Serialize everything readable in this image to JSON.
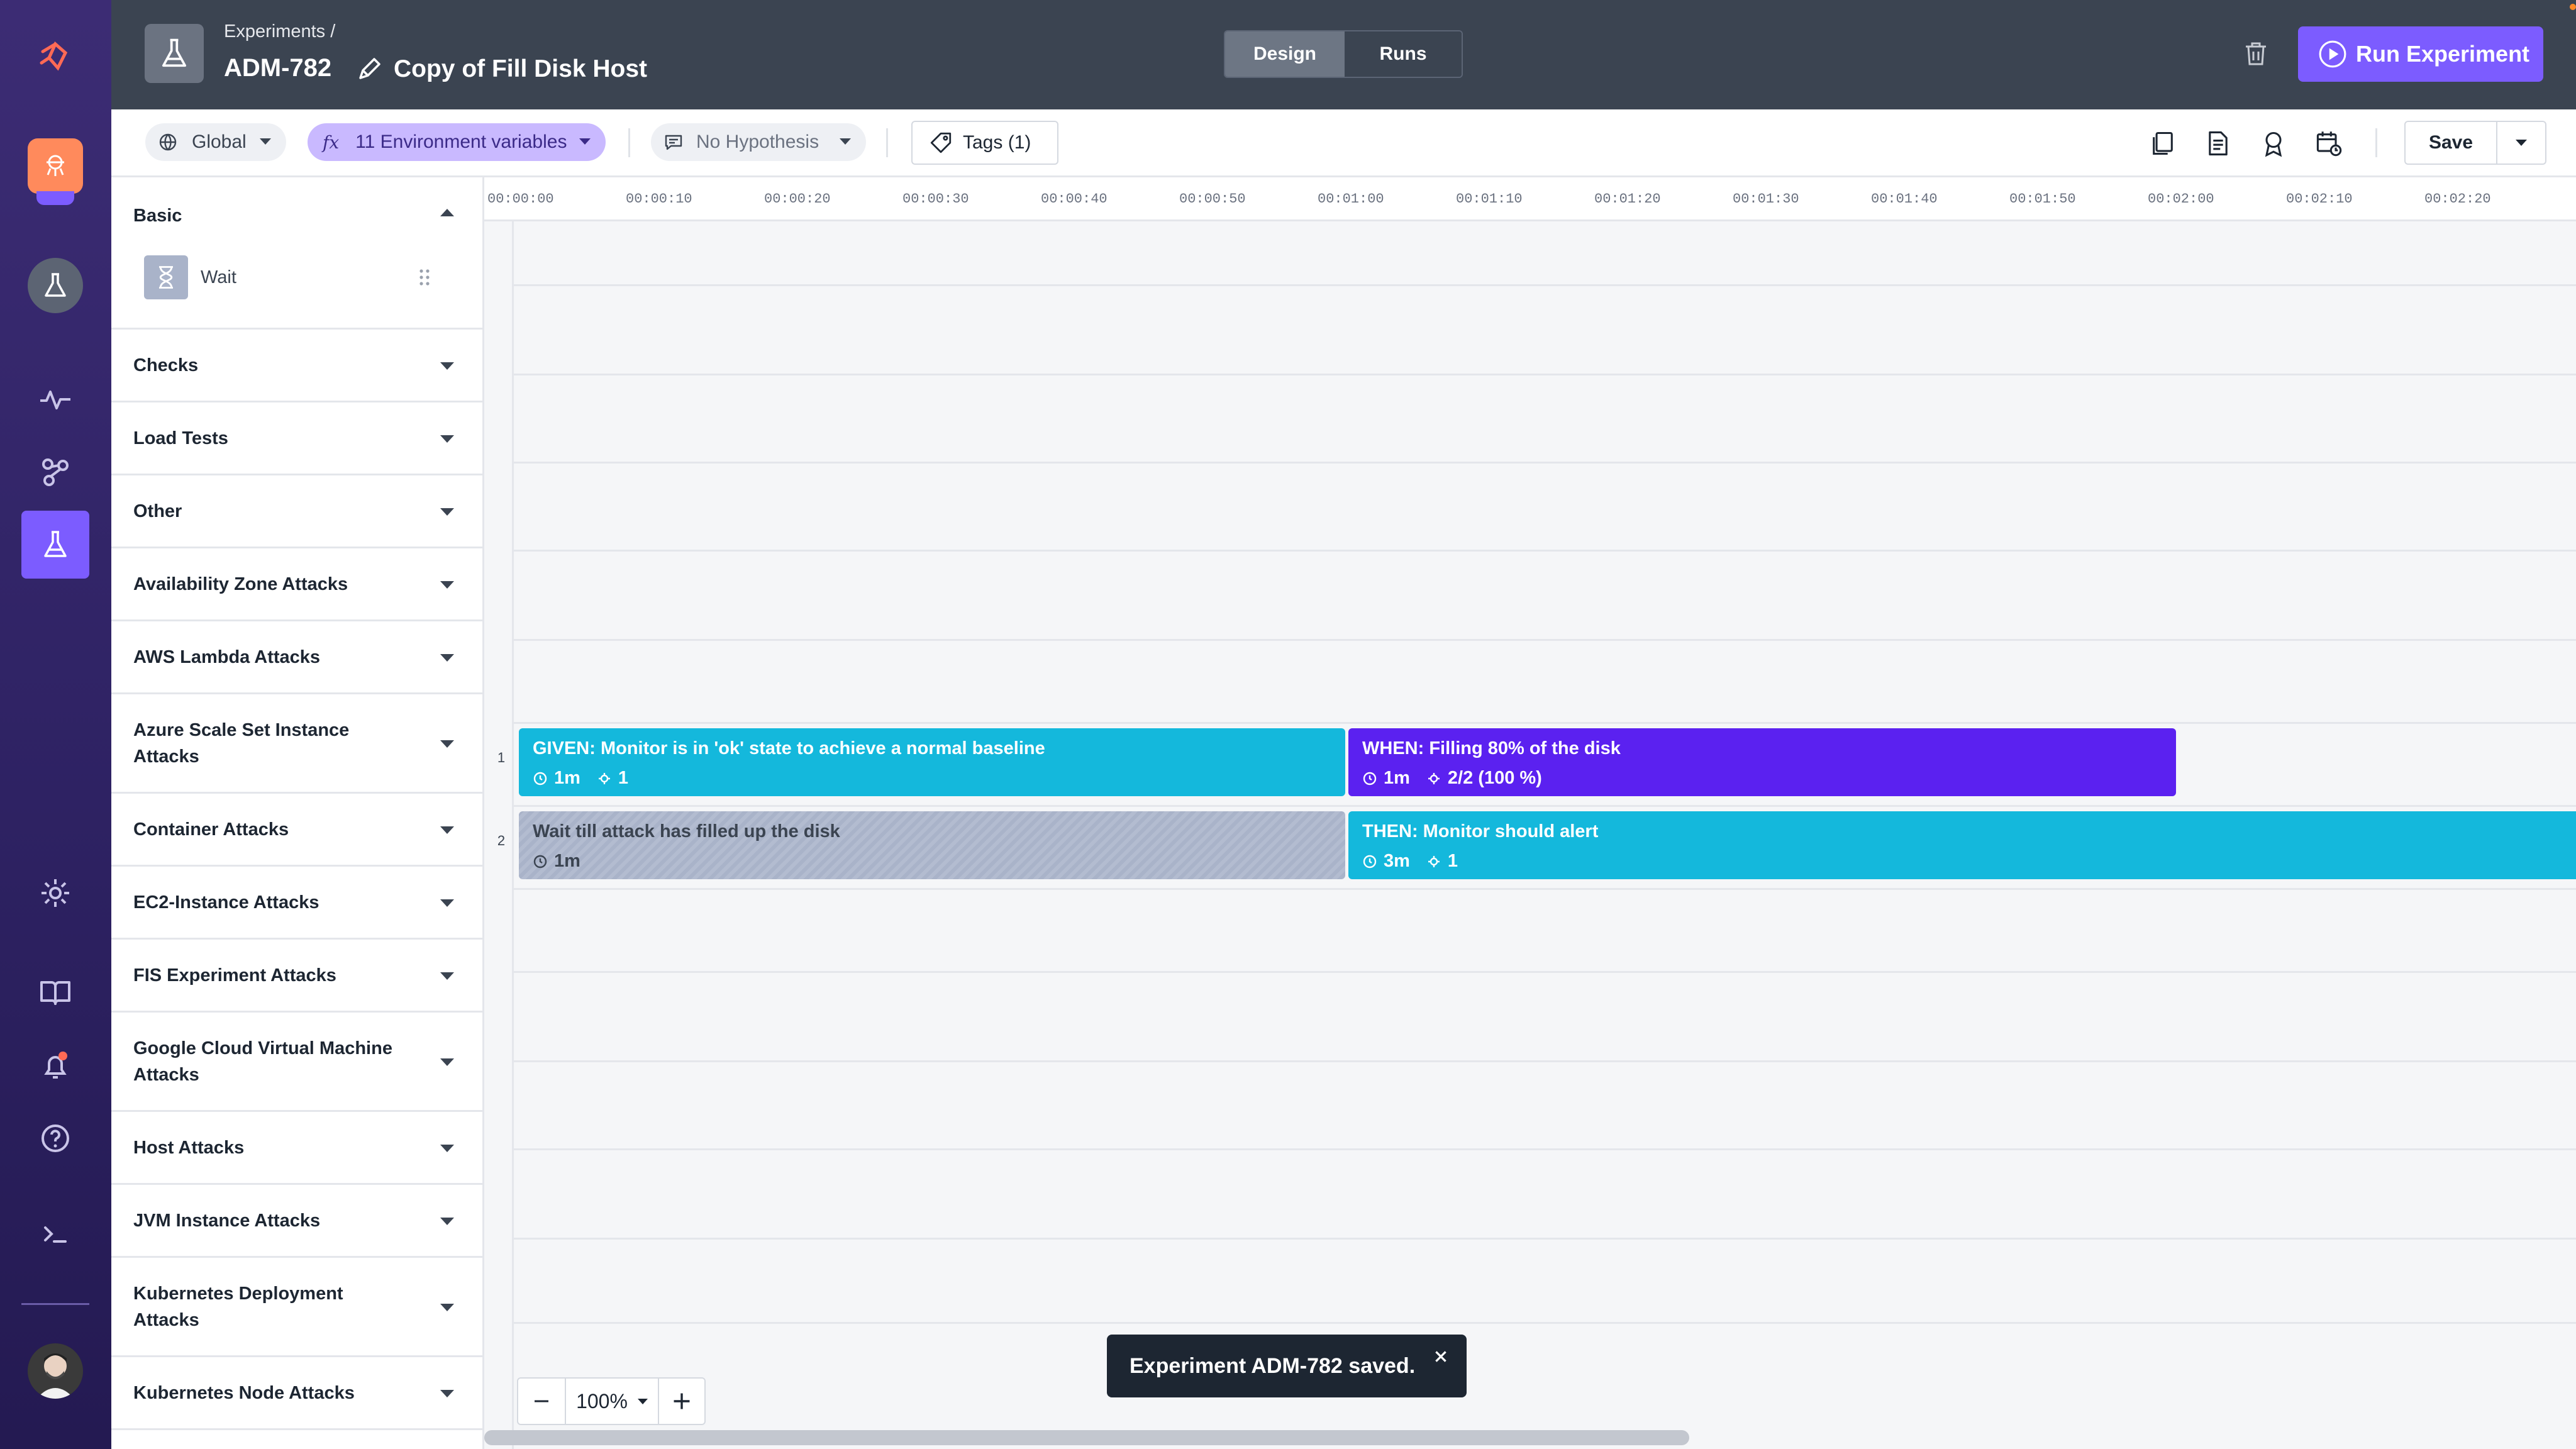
{
  "header": {
    "breadcrumb": "Experiments /",
    "experiment_id": "ADM-782",
    "experiment_name": "Copy of Fill Disk Host",
    "tabs": [
      {
        "label": "Design",
        "active": true
      },
      {
        "label": "Runs",
        "active": false
      }
    ],
    "run_button": "Run Experiment"
  },
  "toolbar": {
    "environment": "Global",
    "env_vars": "11 Environment variables",
    "hypothesis": "No Hypothesis",
    "tags": "Tags (1)",
    "save": "Save"
  },
  "sidebar": {
    "basic_label": "Basic",
    "basic_item": "Wait",
    "sections": [
      "Checks",
      "Load Tests",
      "Other",
      "Availability Zone Attacks",
      "AWS Lambda Attacks",
      "Azure Scale Set Instance Attacks",
      "Container Attacks",
      "EC2-Instance Attacks",
      "FIS Experiment Attacks",
      "Google Cloud Virtual Machine Attacks",
      "Host Attacks",
      "JVM Instance Attacks",
      "Kubernetes Deployment Attacks",
      "Kubernetes Node Attacks"
    ]
  },
  "timeline": {
    "ticks": [
      "00:00:00",
      "00:00:10",
      "00:00:20",
      "00:00:30",
      "00:00:40",
      "00:00:50",
      "00:01:00",
      "00:01:10",
      "00:01:20",
      "00:01:30",
      "00:01:40",
      "00:01:50",
      "00:02:00",
      "00:02:10",
      "00:02:20"
    ],
    "lane_labels": [
      "1",
      "2"
    ],
    "steps": [
      {
        "title": "GIVEN: Monitor is in 'ok' state to achieve a normal baseline",
        "duration": "1m",
        "targets": "1",
        "color": "#14b8dc"
      },
      {
        "title": "WHEN: Filling 80% of the disk",
        "duration": "1m",
        "targets": "2/2 (100 %)",
        "color": "#5b21f0"
      },
      {
        "title": "Wait till attack has filled up the disk",
        "duration": "1m",
        "color": "#a9b3c9"
      },
      {
        "title": "THEN: Monitor should alert",
        "duration": "3m",
        "targets": "1",
        "color": "#14b8dc"
      }
    ]
  },
  "zoom": {
    "value": "100%"
  },
  "toast": {
    "message": "Experiment ADM-782 saved."
  }
}
